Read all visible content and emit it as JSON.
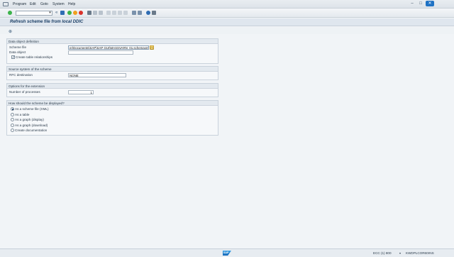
{
  "menubar": {
    "items": [
      "Program",
      "Edit",
      "Goto",
      "System",
      "Help"
    ]
  },
  "window": {
    "minimize": "–",
    "maximize": "□",
    "close": "✕"
  },
  "toolbar": {
    "command_field": "",
    "icons": [
      "enter",
      "save",
      "back",
      "exit",
      "cancel",
      "print",
      "find",
      "find-next",
      "first-page",
      "prev-page",
      "next-page",
      "last-page",
      "new-session",
      "shortcut",
      "help",
      "customize"
    ]
  },
  "title": {
    "text": "Refresh scheme file from local DDIC"
  },
  "groups": {
    "data_object": {
      "header": "Data object definition",
      "scheme_file_label": "Scheme file",
      "scheme_file_value": "er\\Documents\\SAP\\SAP GUI\\MASSVARN_01.schemaxml",
      "data_object_label": "Data object",
      "data_object_value": "",
      "create_rel_label": "Create table relationships",
      "create_rel_checked": true
    },
    "source_system": {
      "header": "Source system of the scheme",
      "rfc_label": "RFC destination",
      "rfc_value": "NONE"
    },
    "extension": {
      "header": "Options for the extension",
      "processes_label": "Number of processes",
      "processes_value": "1"
    },
    "display": {
      "header": "How should the scheme be displayed?",
      "options": [
        {
          "label": "As a scheme file (XML)",
          "checked": true
        },
        {
          "label": "As a table",
          "checked": false
        },
        {
          "label": "As a graph (display)",
          "checked": false
        },
        {
          "label": "As a graph (download)",
          "checked": false
        },
        {
          "label": "Create documentation",
          "checked": false
        }
      ]
    }
  },
  "status": {
    "sap_logo": "SAP",
    "system": "ECC (1) 800",
    "server": "KWDPLCOR60",
    "mode": "INS"
  },
  "colors": {
    "title": "#1c3f66",
    "accent": "#1f72c4"
  }
}
